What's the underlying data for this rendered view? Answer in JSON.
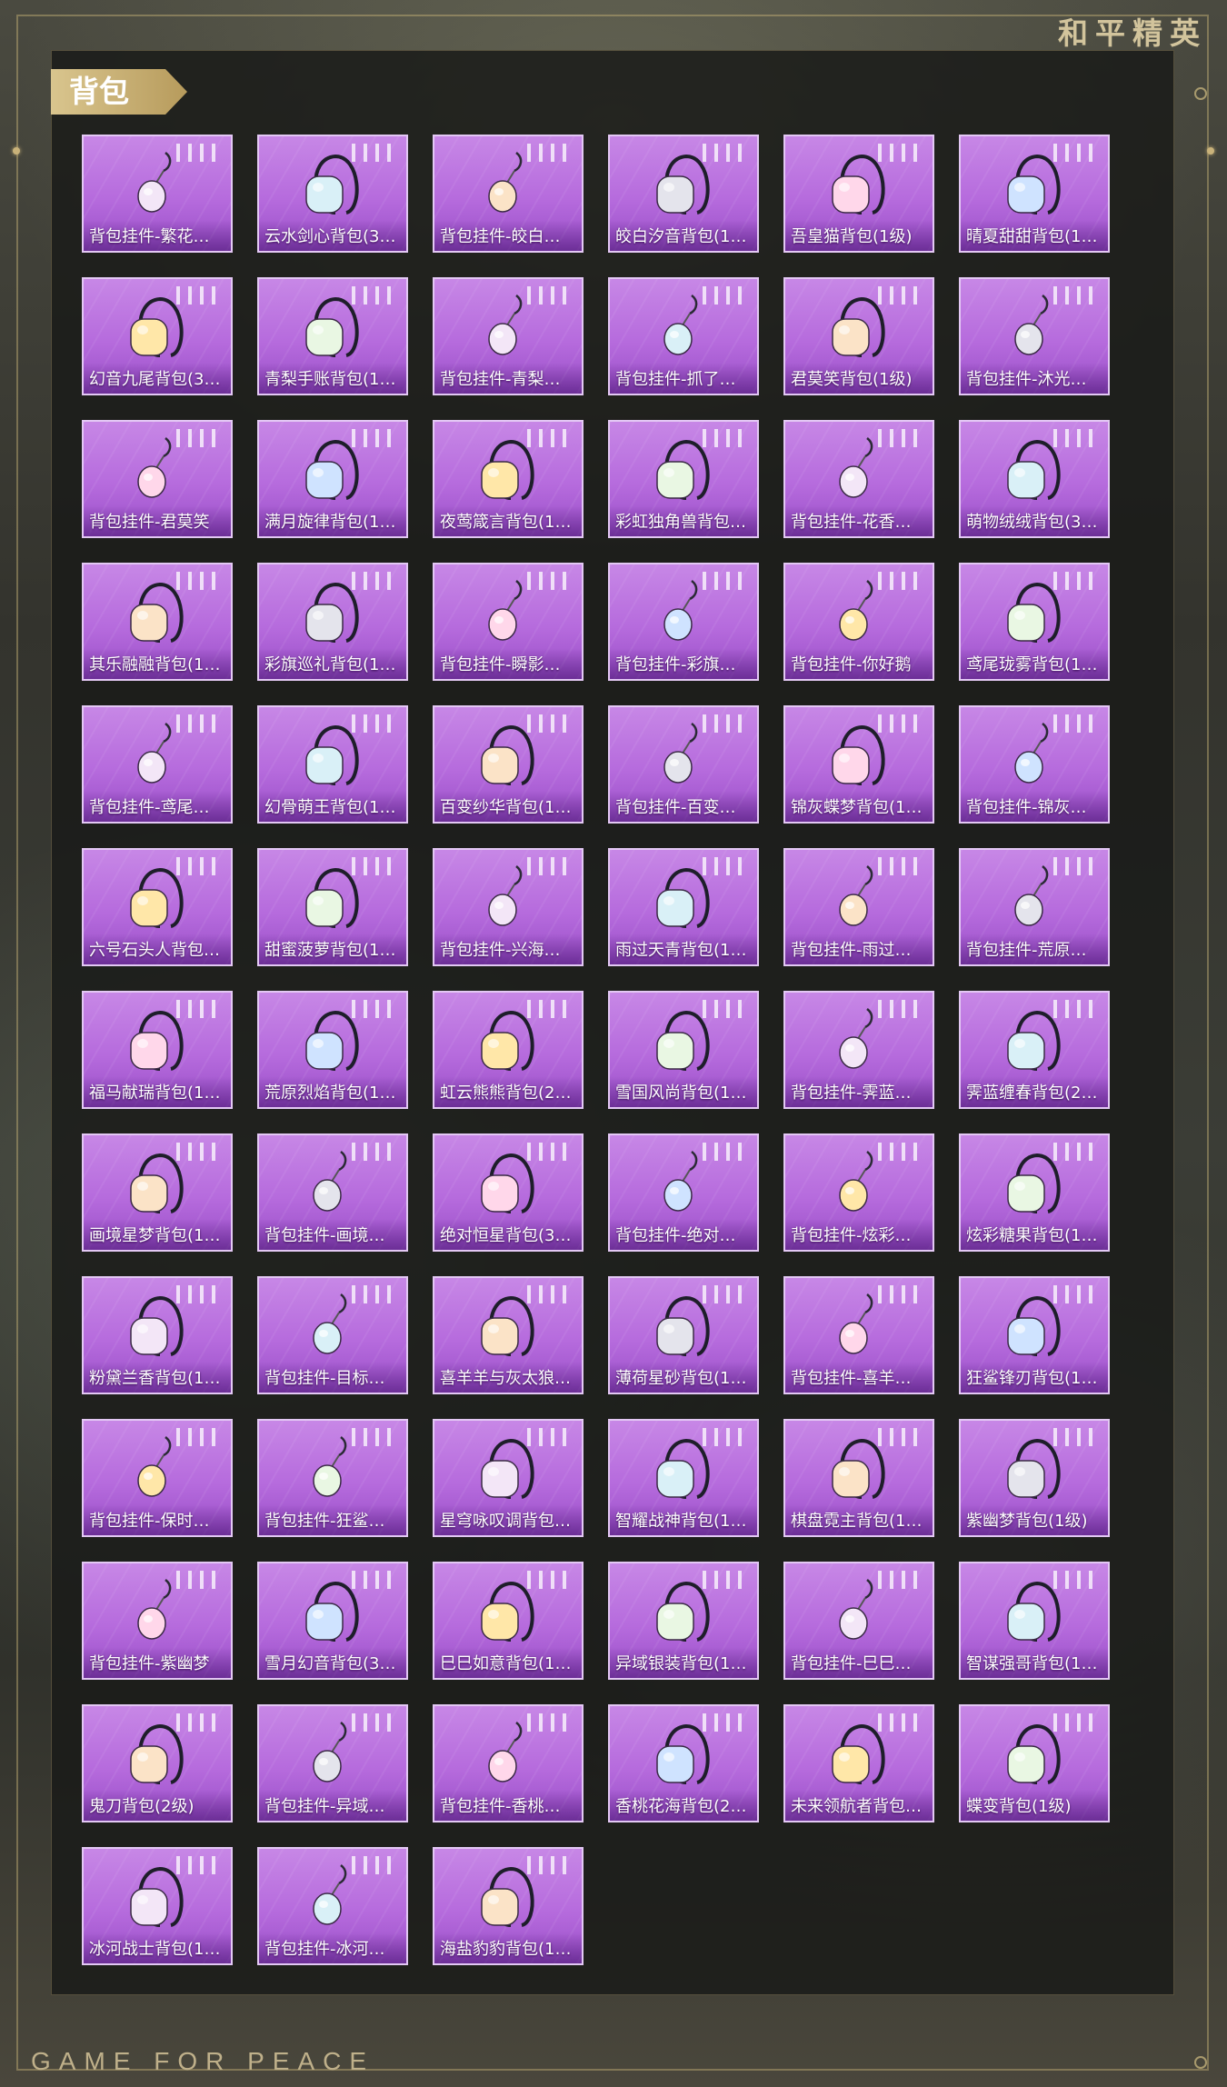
{
  "brand": {
    "cn_title": "和平精英",
    "en_title": "GAME FOR PEACE"
  },
  "section": {
    "title": "背包"
  },
  "colors": {
    "card_top": "#c787e6",
    "card_bottom": "#9a4fc8",
    "card_border": "#e3c8f4",
    "tag_gold": "#d9c58e"
  },
  "items": [
    {
      "label": "背包挂件-繁花…",
      "icon": "pendant-icon"
    },
    {
      "label": "云水剑心背包(3…",
      "icon": "sword-backpack-icon"
    },
    {
      "label": "背包挂件-皎白…",
      "icon": "pendant-icon"
    },
    {
      "label": "皎白汐音背包(1…",
      "icon": "backpack-icon"
    },
    {
      "label": "吾皇猫背包(1级)",
      "icon": "cat-backpack-icon"
    },
    {
      "label": "晴夏甜甜背包(1…",
      "icon": "backpack-icon"
    },
    {
      "label": "幻音九尾背包(3…",
      "icon": "fox-backpack-icon"
    },
    {
      "label": "青梨手账背包(1…",
      "icon": "backpack-icon"
    },
    {
      "label": "背包挂件-青梨…",
      "icon": "pear-pendant-icon"
    },
    {
      "label": "背包挂件-抓了…",
      "icon": "pendant-icon"
    },
    {
      "label": "君莫笑背包(1级)",
      "icon": "backpack-icon"
    },
    {
      "label": "背包挂件-沐光…",
      "icon": "cat-pendant-icon"
    },
    {
      "label": "背包挂件-君莫笑",
      "icon": "umbrella-pendant-icon"
    },
    {
      "label": "满月旋律背包(1…",
      "icon": "backpack-icon"
    },
    {
      "label": "夜莺箴言背包(1…",
      "icon": "backpack-icon"
    },
    {
      "label": "彩虹独角兽背包…",
      "icon": "unicorn-backpack-icon"
    },
    {
      "label": "背包挂件-花香…",
      "icon": "charm-pendant-icon"
    },
    {
      "label": "萌物绒绒背包(3…",
      "icon": "plush-backpack-icon"
    },
    {
      "label": "其乐融融背包(1…",
      "icon": "backpack-icon"
    },
    {
      "label": "彩旗巡礼背包(1…",
      "icon": "bunny-backpack-icon"
    },
    {
      "label": "背包挂件-瞬影…",
      "icon": "blade-pendant-icon"
    },
    {
      "label": "背包挂件-彩旗…",
      "icon": "icecream-pendant-icon"
    },
    {
      "label": "背包挂件-你好鹅",
      "icon": "penguin-pendant-icon"
    },
    {
      "label": "鸢尾珑雾背包(1…",
      "icon": "backpack-icon"
    },
    {
      "label": "背包挂件-鸢尾…",
      "icon": "pendant-icon"
    },
    {
      "label": "幻骨萌王背包(1…",
      "icon": "backpack-icon"
    },
    {
      "label": "百变纱华背包(1…",
      "icon": "backpack-icon"
    },
    {
      "label": "背包挂件-百变…",
      "icon": "heart-pendant-icon"
    },
    {
      "label": "锦灰蝶梦背包(1…",
      "icon": "backpack-icon"
    },
    {
      "label": "背包挂件-锦灰…",
      "icon": "pendant-icon"
    },
    {
      "label": "六号石头人背包…",
      "icon": "backpack-icon"
    },
    {
      "label": "甜蜜菠萝背包(1…",
      "icon": "pineapple-backpack-icon"
    },
    {
      "label": "背包挂件-兴海…",
      "icon": "pendant-icon"
    },
    {
      "label": "雨过天青背包(1…",
      "icon": "backpack-icon"
    },
    {
      "label": "背包挂件-雨过…",
      "icon": "pendant-icon"
    },
    {
      "label": "背包挂件-荒原…",
      "icon": "star-pendant-icon"
    },
    {
      "label": "福马献瑞背包(1…",
      "icon": "backpack-icon"
    },
    {
      "label": "荒原烈焰背包(1…",
      "icon": "backpack-icon"
    },
    {
      "label": "虹云熊熊背包(2…",
      "icon": "bear-backpack-icon"
    },
    {
      "label": "雪国风尚背包(1…",
      "icon": "backpack-icon"
    },
    {
      "label": "背包挂件-霁蓝…",
      "icon": "pendant-icon"
    },
    {
      "label": "霁蓝缠春背包(2…",
      "icon": "backpack-icon"
    },
    {
      "label": "画境星梦背包(1…",
      "icon": "backpack-icon"
    },
    {
      "label": "背包挂件-画境…",
      "icon": "pendant-icon"
    },
    {
      "label": "绝对恒星背包(3…",
      "icon": "box-backpack-icon"
    },
    {
      "label": "背包挂件-绝对…",
      "icon": "pendant-icon"
    },
    {
      "label": "背包挂件-炫彩…",
      "icon": "candy-pendant-icon"
    },
    {
      "label": "炫彩糖果背包(1…",
      "icon": "donut-backpack-icon"
    },
    {
      "label": "粉黛兰香背包(1…",
      "icon": "backpack-icon"
    },
    {
      "label": "背包挂件-目标…",
      "icon": "pendant-icon"
    },
    {
      "label": "喜羊羊与灰太狼…",
      "icon": "sheep-backpack-icon"
    },
    {
      "label": "薄荷星砂背包(1…",
      "icon": "backpack-icon"
    },
    {
      "label": "背包挂件-喜羊…",
      "icon": "bow-pendant-icon"
    },
    {
      "label": "狂鲨锋刃背包(1…",
      "icon": "backpack-icon"
    },
    {
      "label": "背包挂件-保时…",
      "icon": "pendant-icon"
    },
    {
      "label": "背包挂件-狂鲨…",
      "icon": "fin-pendant-icon"
    },
    {
      "label": "星穹咏叹调背包…",
      "icon": "backpack-icon"
    },
    {
      "label": "智耀战神背包(1…",
      "icon": "backpack-icon"
    },
    {
      "label": "棋盘霓主背包(1…",
      "icon": "backpack-icon"
    },
    {
      "label": "紫幽梦背包(1级)",
      "icon": "backpack-icon"
    },
    {
      "label": "背包挂件-紫幽梦",
      "icon": "pendant-icon"
    },
    {
      "label": "雪月幻音背包(3…",
      "icon": "backpack-icon"
    },
    {
      "label": "巳巳如意背包(1…",
      "icon": "backpack-icon"
    },
    {
      "label": "异域银装背包(1…",
      "icon": "backpack-icon"
    },
    {
      "label": "背包挂件-巳巳…",
      "icon": "pendant-icon"
    },
    {
      "label": "智谋强哥背包(1…",
      "icon": "backpack-icon"
    },
    {
      "label": "鬼刀背包(2级)",
      "icon": "backpack-icon"
    },
    {
      "label": "背包挂件-异域…",
      "icon": "wings-pendant-icon"
    },
    {
      "label": "背包挂件-香桃…",
      "icon": "flower-pendant-icon"
    },
    {
      "label": "香桃花海背包(2…",
      "icon": "backpack-icon"
    },
    {
      "label": "未来领航者背包…",
      "icon": "robot-backpack-icon"
    },
    {
      "label": "蝶变背包(1级)",
      "icon": "backpack-icon"
    },
    {
      "label": "冰河战士背包(1…",
      "icon": "backpack-icon"
    },
    {
      "label": "背包挂件-冰河…",
      "icon": "robot-pendant-icon"
    },
    {
      "label": "海盐豹豹背包(1…",
      "icon": "seal-backpack-icon"
    }
  ]
}
